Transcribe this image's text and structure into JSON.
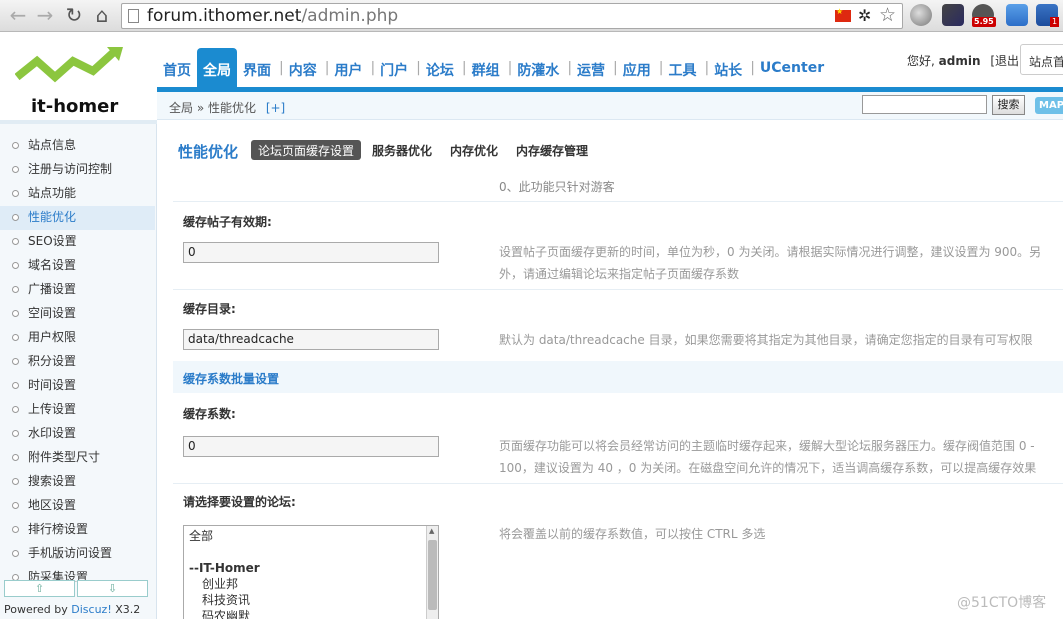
{
  "browser": {
    "url_host": "forum.ithomer.net",
    "url_path": "/admin.php",
    "ext_badge_1": "5.95",
    "ext_badge_2": "1"
  },
  "header": {
    "logo_text": "it-homer",
    "nav": [
      "首页",
      "全局",
      "界面",
      "内容",
      "用户",
      "门户",
      "论坛",
      "群组",
      "防灌水",
      "运营",
      "应用",
      "工具",
      "站长",
      "UCenter"
    ],
    "active_nav": "全局",
    "greeting_prefix": "您好,",
    "username": "admin",
    "logout": "[退出]",
    "station_label": "站点首",
    "breadcrumb": "全局 » 性能优化",
    "breadcrumb_plus": "[+]",
    "search_button": "搜索",
    "map_button": "MAP"
  },
  "sidebar": {
    "items": [
      "站点信息",
      "注册与访问控制",
      "站点功能",
      "性能优化",
      "SEO设置",
      "域名设置",
      "广播设置",
      "空间设置",
      "用户权限",
      "积分设置",
      "时间设置",
      "上传设置",
      "水印设置",
      "附件类型尺寸",
      "搜索设置",
      "地区设置",
      "排行榜设置",
      "手机版访问设置",
      "防采集设置"
    ],
    "active_index": 3,
    "scroll_up": "⇧",
    "scroll_down": "⇩",
    "powered_prefix": "Powered by",
    "powered_brand": "Discuz!",
    "powered_version": "X3.2"
  },
  "main": {
    "title": "性能优化",
    "tabs": [
      "论坛页面缓存设置",
      "服务器优化",
      "内存优化",
      "内存缓存管理"
    ],
    "active_tab": 0,
    "note_top": "0、此功能只针对游客",
    "fields": [
      {
        "label": "缓存帖子有效期:",
        "value": "0",
        "desc": "设置帖子页面缓存更新的时间，单位为秒，0 为关闭。请根据实际情况进行调整，建议设置为 900。另外，请通过编辑论坛来指定帖子页面缓存系数"
      },
      {
        "label": "缓存目录:",
        "value": "data/threadcache",
        "desc": "默认为 data/threadcache 目录，如果您需要将其指定为其他目录，请确定您指定的目录有可写权限"
      },
      {
        "label": "缓存系数:",
        "value": "0",
        "desc": "页面缓存功能可以将会员经常访问的主题临时缓存起来，缓解大型论坛服务器压力。缓存阀值范围 0 - 100，建议设置为 40 ，0 为关闭。在磁盘空间允许的情况下，适当调高缓存系数，可以提高缓存效果"
      }
    ],
    "section_title": "缓存系数批量设置",
    "forum_select_label": "请选择要设置的论坛:",
    "forum_select_desc": "将会覆盖以前的缓存系数值，可以按住 CTRL 多选",
    "forum_options": [
      {
        "text": "全部",
        "kind": "normal"
      },
      {
        "text": "",
        "kind": "blank"
      },
      {
        "text": "--IT-Homer",
        "kind": "group"
      },
      {
        "text": "创业邦",
        "kind": "child"
      },
      {
        "text": "科技资讯",
        "kind": "child"
      },
      {
        "text": "码农幽默",
        "kind": "child"
      }
    ]
  },
  "watermark": "@51CTO博客"
}
